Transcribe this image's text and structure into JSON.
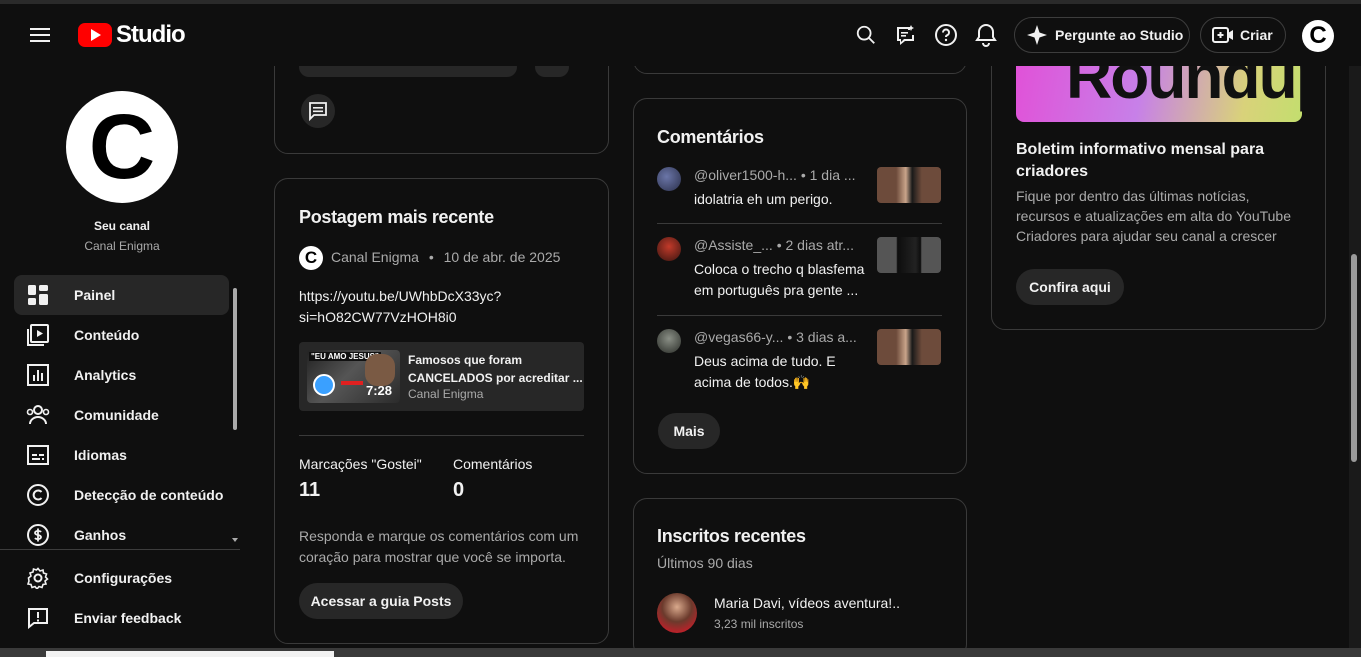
{
  "header": {
    "logo_text": "Studio",
    "ask_studio": "Pergunte ao Studio",
    "create": "Criar",
    "avatar_letter": "C"
  },
  "sidebar": {
    "avatar_letter": "C",
    "channel_title": "Seu canal",
    "channel_name": "Canal Enigma",
    "items": [
      {
        "label": "Painel",
        "icon": "dashboard-icon"
      },
      {
        "label": "Conteúdo",
        "icon": "content-icon"
      },
      {
        "label": "Analytics",
        "icon": "analytics-icon"
      },
      {
        "label": "Comunidade",
        "icon": "community-icon"
      },
      {
        "label": "Idiomas",
        "icon": "subtitles-icon"
      },
      {
        "label": "Detecção de conteúdo",
        "icon": "copyright-icon"
      },
      {
        "label": "Ganhos",
        "icon": "earn-icon"
      }
    ],
    "bottom_items": [
      {
        "label": "Configurações",
        "icon": "gear-icon"
      },
      {
        "label": "Enviar feedback",
        "icon": "feedback-icon"
      }
    ]
  },
  "post_card": {
    "title": "Postagem mais recente",
    "author": "Canal Enigma",
    "dot": "•",
    "date": "10 de abr. de 2025",
    "link_line1": "https://youtu.be/UWhbDcX33yc?",
    "link_line2": "si=hO82CW77VzHOH8i0",
    "video_title_line1": "Famosos que foram",
    "video_title_line2": "CANCELADOS por acreditar ...",
    "video_channel": "Canal Enigma",
    "video_duration": "7:28",
    "thumb_text": "\"EU AMO JESUS\"",
    "likes_label": "Marcações \"Gostei\"",
    "likes_value": "11",
    "comments_label": "Comentários",
    "comments_value": "0",
    "prompt_line1": "Responda e marque os comentários com um",
    "prompt_line2": "coração para mostrar que você se importa.",
    "button": "Acessar a guia Posts"
  },
  "comments_card": {
    "title": "Comentários",
    "items": [
      {
        "author": "@oliver1500-h...",
        "time": "• 1 dia ...",
        "text1": "idolatria eh um perigo.",
        "text2": ""
      },
      {
        "author": "@Assiste_...",
        "time": "• 2 dias atr...",
        "text1": "Coloca o trecho q blasfema",
        "text2": "em português pra gente ..."
      },
      {
        "author": "@vegas66-y...",
        "time": "• 3 dias a...",
        "text1": "Deus acima de tudo. E",
        "text2": "acima de todos.🙌"
      }
    ],
    "more": "Mais"
  },
  "subs_card": {
    "title": "Inscritos recentes",
    "subtitle": "Últimos 90 dias",
    "sub_name": "Maria Davi, vídeos aventura!..",
    "sub_count": "3,23 mil inscritos"
  },
  "newsletter_card": {
    "banner_text": "Roundup",
    "title_line1": "Boletim informativo mensal para",
    "title_line2": "criadores",
    "desc_line1": "Fique por dentro das últimas notícias,",
    "desc_line2": "recursos e atualizações em alta do YouTube",
    "desc_line3": "Criadores para ajudar seu canal a crescer",
    "button": "Confira aqui"
  }
}
